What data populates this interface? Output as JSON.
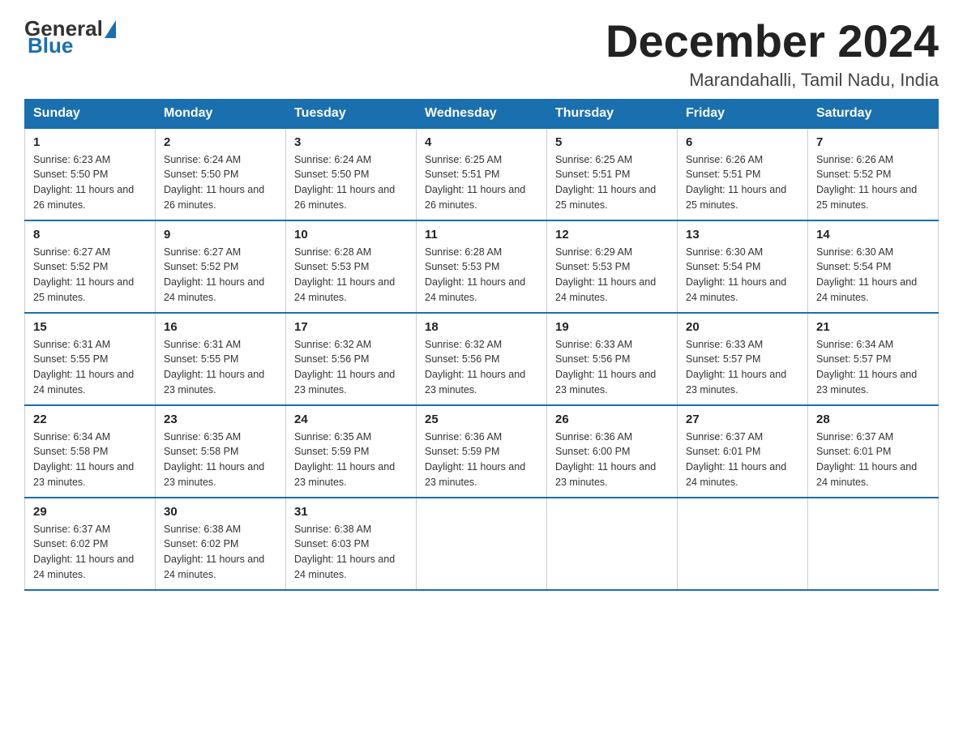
{
  "logo": {
    "general": "General",
    "blue": "Blue"
  },
  "title": "December 2024",
  "subtitle": "Marandahalli, Tamil Nadu, India",
  "days": [
    "Sunday",
    "Monday",
    "Tuesday",
    "Wednesday",
    "Thursday",
    "Friday",
    "Saturday"
  ],
  "weeks": [
    [
      {
        "day": "1",
        "sunrise": "Sunrise: 6:23 AM",
        "sunset": "Sunset: 5:50 PM",
        "daylight": "Daylight: 11 hours and 26 minutes."
      },
      {
        "day": "2",
        "sunrise": "Sunrise: 6:24 AM",
        "sunset": "Sunset: 5:50 PM",
        "daylight": "Daylight: 11 hours and 26 minutes."
      },
      {
        "day": "3",
        "sunrise": "Sunrise: 6:24 AM",
        "sunset": "Sunset: 5:50 PM",
        "daylight": "Daylight: 11 hours and 26 minutes."
      },
      {
        "day": "4",
        "sunrise": "Sunrise: 6:25 AM",
        "sunset": "Sunset: 5:51 PM",
        "daylight": "Daylight: 11 hours and 26 minutes."
      },
      {
        "day": "5",
        "sunrise": "Sunrise: 6:25 AM",
        "sunset": "Sunset: 5:51 PM",
        "daylight": "Daylight: 11 hours and 25 minutes."
      },
      {
        "day": "6",
        "sunrise": "Sunrise: 6:26 AM",
        "sunset": "Sunset: 5:51 PM",
        "daylight": "Daylight: 11 hours and 25 minutes."
      },
      {
        "day": "7",
        "sunrise": "Sunrise: 6:26 AM",
        "sunset": "Sunset: 5:52 PM",
        "daylight": "Daylight: 11 hours and 25 minutes."
      }
    ],
    [
      {
        "day": "8",
        "sunrise": "Sunrise: 6:27 AM",
        "sunset": "Sunset: 5:52 PM",
        "daylight": "Daylight: 11 hours and 25 minutes."
      },
      {
        "day": "9",
        "sunrise": "Sunrise: 6:27 AM",
        "sunset": "Sunset: 5:52 PM",
        "daylight": "Daylight: 11 hours and 24 minutes."
      },
      {
        "day": "10",
        "sunrise": "Sunrise: 6:28 AM",
        "sunset": "Sunset: 5:53 PM",
        "daylight": "Daylight: 11 hours and 24 minutes."
      },
      {
        "day": "11",
        "sunrise": "Sunrise: 6:28 AM",
        "sunset": "Sunset: 5:53 PM",
        "daylight": "Daylight: 11 hours and 24 minutes."
      },
      {
        "day": "12",
        "sunrise": "Sunrise: 6:29 AM",
        "sunset": "Sunset: 5:53 PM",
        "daylight": "Daylight: 11 hours and 24 minutes."
      },
      {
        "day": "13",
        "sunrise": "Sunrise: 6:30 AM",
        "sunset": "Sunset: 5:54 PM",
        "daylight": "Daylight: 11 hours and 24 minutes."
      },
      {
        "day": "14",
        "sunrise": "Sunrise: 6:30 AM",
        "sunset": "Sunset: 5:54 PM",
        "daylight": "Daylight: 11 hours and 24 minutes."
      }
    ],
    [
      {
        "day": "15",
        "sunrise": "Sunrise: 6:31 AM",
        "sunset": "Sunset: 5:55 PM",
        "daylight": "Daylight: 11 hours and 24 minutes."
      },
      {
        "day": "16",
        "sunrise": "Sunrise: 6:31 AM",
        "sunset": "Sunset: 5:55 PM",
        "daylight": "Daylight: 11 hours and 23 minutes."
      },
      {
        "day": "17",
        "sunrise": "Sunrise: 6:32 AM",
        "sunset": "Sunset: 5:56 PM",
        "daylight": "Daylight: 11 hours and 23 minutes."
      },
      {
        "day": "18",
        "sunrise": "Sunrise: 6:32 AM",
        "sunset": "Sunset: 5:56 PM",
        "daylight": "Daylight: 11 hours and 23 minutes."
      },
      {
        "day": "19",
        "sunrise": "Sunrise: 6:33 AM",
        "sunset": "Sunset: 5:56 PM",
        "daylight": "Daylight: 11 hours and 23 minutes."
      },
      {
        "day": "20",
        "sunrise": "Sunrise: 6:33 AM",
        "sunset": "Sunset: 5:57 PM",
        "daylight": "Daylight: 11 hours and 23 minutes."
      },
      {
        "day": "21",
        "sunrise": "Sunrise: 6:34 AM",
        "sunset": "Sunset: 5:57 PM",
        "daylight": "Daylight: 11 hours and 23 minutes."
      }
    ],
    [
      {
        "day": "22",
        "sunrise": "Sunrise: 6:34 AM",
        "sunset": "Sunset: 5:58 PM",
        "daylight": "Daylight: 11 hours and 23 minutes."
      },
      {
        "day": "23",
        "sunrise": "Sunrise: 6:35 AM",
        "sunset": "Sunset: 5:58 PM",
        "daylight": "Daylight: 11 hours and 23 minutes."
      },
      {
        "day": "24",
        "sunrise": "Sunrise: 6:35 AM",
        "sunset": "Sunset: 5:59 PM",
        "daylight": "Daylight: 11 hours and 23 minutes."
      },
      {
        "day": "25",
        "sunrise": "Sunrise: 6:36 AM",
        "sunset": "Sunset: 5:59 PM",
        "daylight": "Daylight: 11 hours and 23 minutes."
      },
      {
        "day": "26",
        "sunrise": "Sunrise: 6:36 AM",
        "sunset": "Sunset: 6:00 PM",
        "daylight": "Daylight: 11 hours and 23 minutes."
      },
      {
        "day": "27",
        "sunrise": "Sunrise: 6:37 AM",
        "sunset": "Sunset: 6:01 PM",
        "daylight": "Daylight: 11 hours and 24 minutes."
      },
      {
        "day": "28",
        "sunrise": "Sunrise: 6:37 AM",
        "sunset": "Sunset: 6:01 PM",
        "daylight": "Daylight: 11 hours and 24 minutes."
      }
    ],
    [
      {
        "day": "29",
        "sunrise": "Sunrise: 6:37 AM",
        "sunset": "Sunset: 6:02 PM",
        "daylight": "Daylight: 11 hours and 24 minutes."
      },
      {
        "day": "30",
        "sunrise": "Sunrise: 6:38 AM",
        "sunset": "Sunset: 6:02 PM",
        "daylight": "Daylight: 11 hours and 24 minutes."
      },
      {
        "day": "31",
        "sunrise": "Sunrise: 6:38 AM",
        "sunset": "Sunset: 6:03 PM",
        "daylight": "Daylight: 11 hours and 24 minutes."
      },
      null,
      null,
      null,
      null
    ]
  ]
}
